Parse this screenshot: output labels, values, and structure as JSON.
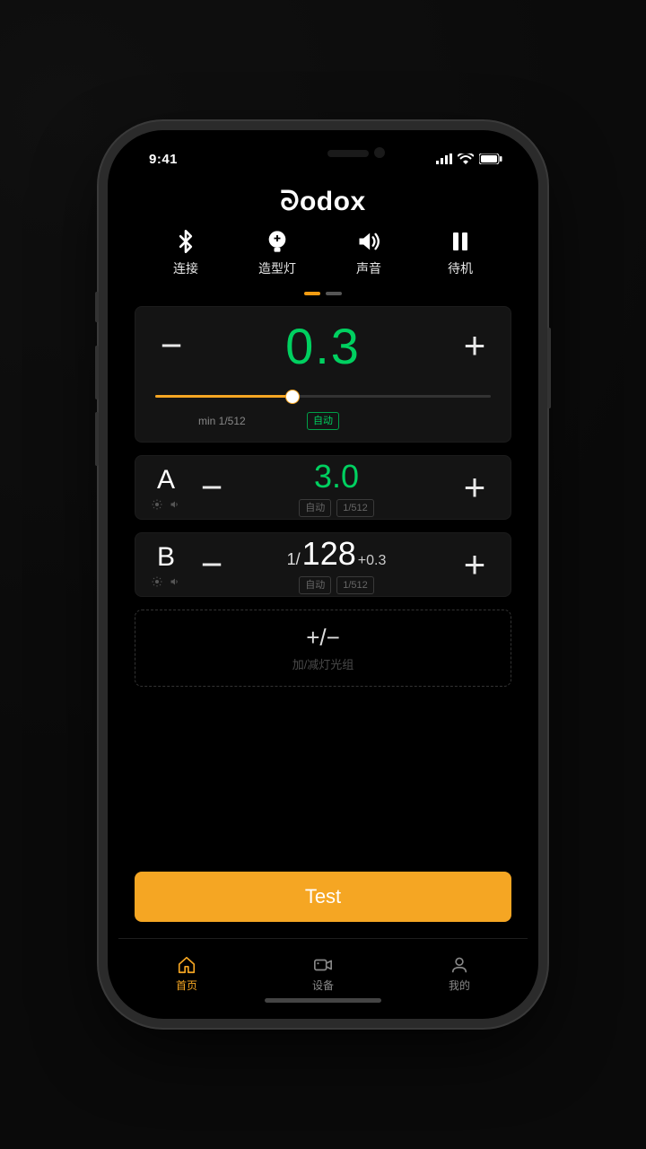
{
  "status": {
    "time": "9:41"
  },
  "brand": "Godox",
  "topicons": {
    "connect": "连接",
    "model_light": "造型灯",
    "sound": "声音",
    "standby": "待机"
  },
  "main": {
    "value": "0.3",
    "min_label": "min 1/512",
    "auto_chip": "自动"
  },
  "groups": [
    {
      "id": "A",
      "value": "3.0",
      "auto": "自动",
      "ratio": "1/512"
    },
    {
      "id": "B",
      "prefix": "1/",
      "value": "128",
      "suffix": "+0.3",
      "auto": "自动",
      "ratio": "1/512"
    }
  ],
  "add_group": {
    "symbol": "+/−",
    "label": "加/减灯光组"
  },
  "test_button": "Test",
  "tabs": {
    "home": "首页",
    "device": "设备",
    "mine": "我的"
  }
}
